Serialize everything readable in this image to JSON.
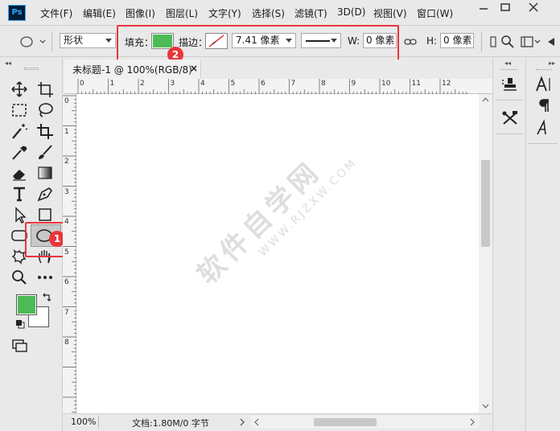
{
  "app": {
    "logo": "Ps"
  },
  "menu": [
    "文件(F)",
    "编辑(E)",
    "图像(I)",
    "图层(L)",
    "文字(Y)",
    "选择(S)",
    "滤镜(T)",
    "3D(D)",
    "视图(V)",
    "窗口(W)"
  ],
  "options": {
    "shape_mode": "形状",
    "fill_label": "填充：",
    "fill_color": "#4cbb55",
    "stroke_label": "描边：",
    "stroke_width": "7.41 像素",
    "w_label": "W:",
    "w_value": "0 像素",
    "h_label": "H:",
    "h_value": "0 像素"
  },
  "annotations": {
    "badge1": "1",
    "badge2": "2",
    "accent": "#e8363c"
  },
  "document": {
    "tab_title": "未标题-1 @ 100%(RGB/8)",
    "tab_close": "×",
    "zoom": "100%",
    "doc_info": "文档:1.80M/0 字节",
    "ruler_top_labels": [
      "0",
      "1",
      "2",
      "3",
      "4",
      "5",
      "6",
      "7",
      "8",
      "9",
      "10",
      "11",
      "12"
    ],
    "ruler_left_labels": [
      "0",
      "1",
      "2",
      "3",
      "4",
      "5",
      "6",
      "7",
      "8"
    ]
  },
  "colors": {
    "foreground": "#4cbb55",
    "background": "#ffffff"
  },
  "watermark": {
    "main": "软件自学网",
    "sub": "WWW.RJZXW.COM"
  }
}
